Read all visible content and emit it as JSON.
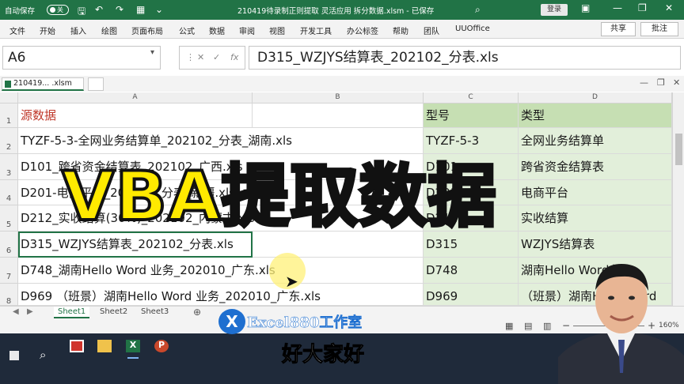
{
  "titlebar": {
    "autosave_label": "自动保存",
    "autosave_state": "关",
    "title": "210419待录制正则提取 灵活应用 拆分数据.xlsm - 已保存",
    "search_placeholder": "搜索",
    "login_label": "登录"
  },
  "menu": {
    "items": [
      "文件",
      "开始",
      "插入",
      "绘图",
      "页面布局",
      "公式",
      "数据",
      "审阅",
      "视图",
      "开发工具",
      "办公标签",
      "帮助",
      "团队",
      "UUOffice"
    ],
    "share_label": "共享",
    "notes_label": "批注"
  },
  "formula_bar": {
    "cell_ref": "A6",
    "fx_label": "fx",
    "content": "D315_WZJYS结算表_202102_分表.xls"
  },
  "doc_tabs": {
    "active_tab": "210419... .xlsm"
  },
  "columns": [
    "A",
    "B",
    "C",
    "D"
  ],
  "rows": [
    {
      "num": "1",
      "a": "源数据",
      "c": "型号",
      "d": "类型"
    },
    {
      "num": "2",
      "a": "TYZF-5-3-全网业务结算单_202102_分表_湖南.xls",
      "c": "TYZF-5-3",
      "d": "全网业务结算单"
    },
    {
      "num": "3",
      "a": "D101_跨省资金结算表_202102_广西.xls",
      "c": "D101",
      "d": "跨省资金结算表"
    },
    {
      "num": "4",
      "a": "D201-电商平台_202102_分表_新疆.xls",
      "c": "D201",
      "d": "电商平台"
    },
    {
      "num": "5",
      "a": "D212_实收结算(30%)_202102_内蒙古.xls",
      "c": "D212",
      "d": "实收结算"
    },
    {
      "num": "6",
      "a": "D315_WZJYS结算表_202102_分表.xls",
      "c": "D315",
      "d": "WZJYS结算表"
    },
    {
      "num": "7",
      "a": "D748_湖南Hello Word 业务_202010_广东.xls",
      "c": "D748",
      "d": "湖南Hello Word业务"
    },
    {
      "num": "8",
      "a": "D969 （班景）湖南Hello Word 业务_202010_广东.xls",
      "c": "D969",
      "d": "（班景）湖南Hello Word"
    }
  ],
  "sheets": [
    "Sheet1",
    "Sheet2",
    "Sheet3"
  ],
  "status": {
    "zoom": "160%"
  },
  "overlay": {
    "title": "VBA提取数据",
    "subtitle": "好大家好",
    "watermark_badge": "X",
    "watermark_text": "Excel880工作室"
  },
  "colors": {
    "excel_green": "#217346",
    "header_green": "#c6dfb3",
    "cell_green": "#e2efda",
    "title_yellow": "#ffea00"
  }
}
